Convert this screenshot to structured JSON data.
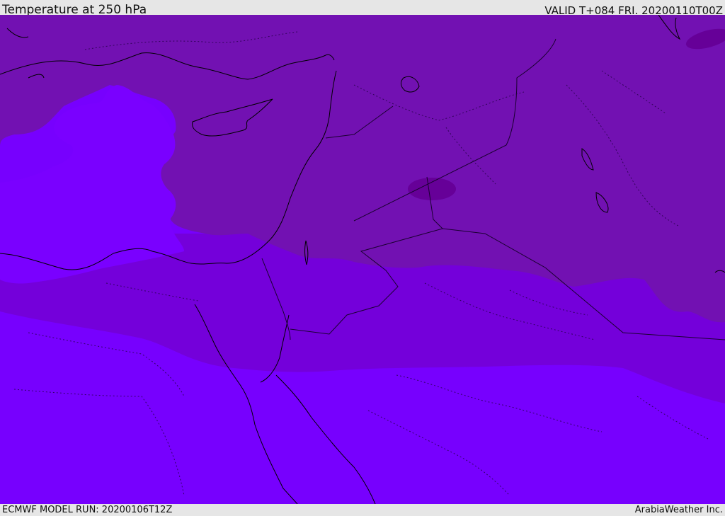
{
  "header": {
    "title": "Temperature at 250 hPa",
    "valid_time": "VALID T+084 FRI. 20200110T00Z"
  },
  "footer": {
    "model_run": "ECMWF MODEL RUN: 20200106T12Z",
    "credit": "ArabiaWeather Inc."
  },
  "map": {
    "field": "temperature",
    "level": "250 hPa",
    "colors": {
      "band_coldest": "#660098",
      "band_cold": "#7211b2",
      "band_mid": "#7400da",
      "band_warm": "#7700fe",
      "band_pocket": "#7a00ff",
      "coastline": "#000000",
      "border": "#1a0030"
    }
  }
}
